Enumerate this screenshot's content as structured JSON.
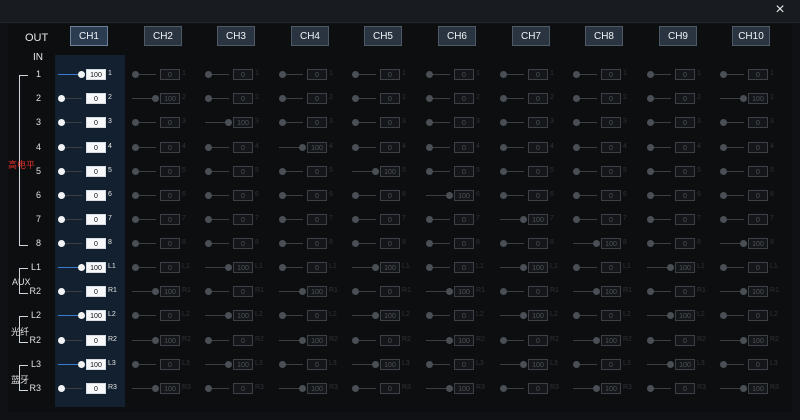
{
  "window": {
    "close_icon": "×"
  },
  "header": {
    "out_label": "OUT",
    "in_label": "IN"
  },
  "channels": [
    "CH1",
    "CH2",
    "CH3",
    "CH4",
    "CH5",
    "CH6",
    "CH7",
    "CH8",
    "CH9",
    "CH10"
  ],
  "active_channel": 0,
  "inputs": [
    {
      "label": "1",
      "tag": "1"
    },
    {
      "label": "2",
      "tag": "2"
    },
    {
      "label": "3",
      "tag": "3"
    },
    {
      "label": "4",
      "tag": "4"
    },
    {
      "label": "5",
      "tag": "5"
    },
    {
      "label": "6",
      "tag": "6"
    },
    {
      "label": "7",
      "tag": "7"
    },
    {
      "label": "8",
      "tag": "8"
    },
    {
      "label": "L1",
      "tag": "L1"
    },
    {
      "label": "R2",
      "tag": "R1"
    },
    {
      "label": "L2",
      "tag": "L2"
    },
    {
      "label": "R2",
      "tag": "R2"
    },
    {
      "label": "L3",
      "tag": "L3"
    },
    {
      "label": "R3",
      "tag": "R3"
    }
  ],
  "groups": [
    {
      "label": "高电平",
      "color": "#e0302a"
    },
    {
      "label": "AUX",
      "color": "#e0e0e0"
    },
    {
      "label": "光纤",
      "color": "#e0e0e0"
    },
    {
      "label": "蓝牙",
      "color": "#e0e0e0"
    }
  ],
  "values": [
    [
      100,
      0,
      0,
      0,
      0,
      0,
      0,
      0,
      0,
      0
    ],
    [
      0,
      100,
      0,
      0,
      0,
      0,
      0,
      0,
      0,
      100
    ],
    [
      0,
      0,
      100,
      0,
      0,
      0,
      0,
      0,
      0,
      0
    ],
    [
      0,
      0,
      0,
      100,
      0,
      0,
      0,
      0,
      0,
      0
    ],
    [
      0,
      0,
      0,
      0,
      100,
      0,
      0,
      0,
      0,
      0
    ],
    [
      0,
      0,
      0,
      0,
      0,
      100,
      0,
      0,
      0,
      0
    ],
    [
      0,
      0,
      0,
      0,
      0,
      0,
      100,
      0,
      0,
      0
    ],
    [
      0,
      0,
      0,
      0,
      0,
      0,
      0,
      100,
      0,
      100
    ],
    [
      100,
      0,
      100,
      0,
      100,
      0,
      100,
      0,
      100,
      0
    ],
    [
      0,
      100,
      0,
      100,
      0,
      100,
      0,
      100,
      0,
      100
    ],
    [
      100,
      0,
      100,
      0,
      100,
      0,
      100,
      0,
      100,
      0
    ],
    [
      0,
      100,
      0,
      100,
      0,
      100,
      0,
      100,
      0,
      100
    ],
    [
      100,
      0,
      100,
      0,
      100,
      0,
      100,
      0,
      100,
      0
    ],
    [
      0,
      100,
      0,
      100,
      0,
      100,
      0,
      100,
      0,
      100
    ]
  ]
}
